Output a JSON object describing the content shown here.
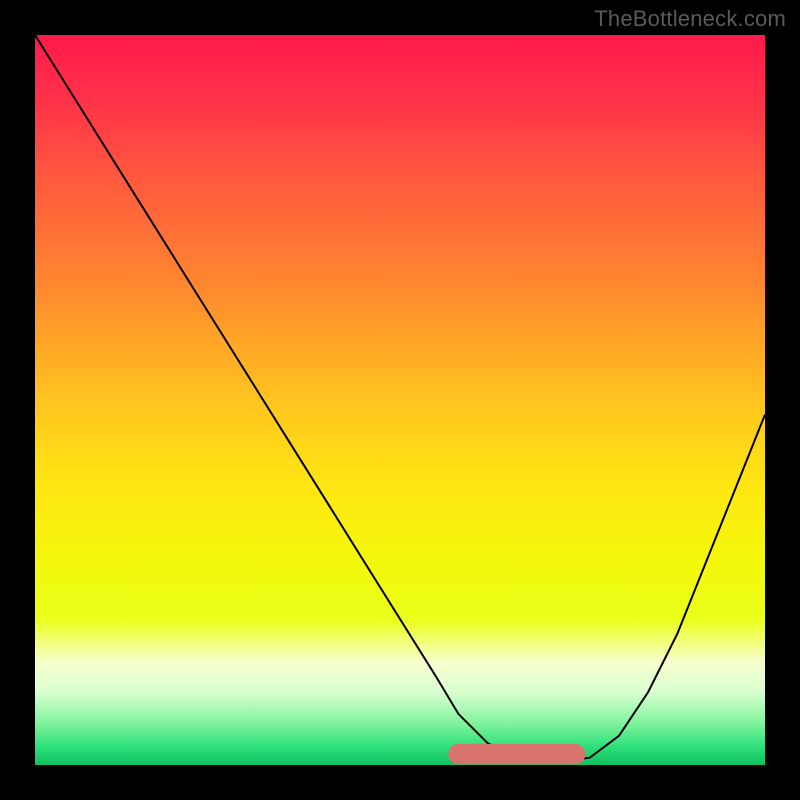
{
  "watermark": "TheBottleneck.com",
  "chart_data": {
    "type": "line",
    "title": "",
    "xlabel": "",
    "ylabel": "",
    "xlim": [
      0,
      100
    ],
    "ylim": [
      0,
      100
    ],
    "background_gradient": {
      "stops": [
        {
          "offset": 0.0,
          "color": "#ff1a4a"
        },
        {
          "offset": 0.08,
          "color": "#ff2f4a"
        },
        {
          "offset": 0.2,
          "color": "#ff5a3e"
        },
        {
          "offset": 0.35,
          "color": "#ff8a2e"
        },
        {
          "offset": 0.5,
          "color": "#ffc41f"
        },
        {
          "offset": 0.62,
          "color": "#ffe712"
        },
        {
          "offset": 0.72,
          "color": "#f4f80a"
        },
        {
          "offset": 0.8,
          "color": "#e9ff1a"
        },
        {
          "offset": 0.86,
          "color": "#f8ffd0"
        },
        {
          "offset": 0.9,
          "color": "#d9ffd0"
        },
        {
          "offset": 0.94,
          "color": "#86f5a0"
        },
        {
          "offset": 0.975,
          "color": "#2ee07a"
        },
        {
          "offset": 1.0,
          "color": "#10c060"
        }
      ]
    },
    "series": [
      {
        "name": "bottleneck-curve",
        "stroke": "#000000",
        "stroke_width": 2,
        "x": [
          0,
          5,
          10,
          15,
          20,
          25,
          30,
          35,
          40,
          45,
          50,
          55,
          58,
          62,
          66,
          70,
          72,
          76,
          80,
          84,
          88,
          92,
          96,
          100
        ],
        "y": [
          100,
          92,
          84,
          76,
          68,
          60,
          52,
          44,
          36,
          28,
          20,
          12,
          7,
          3,
          1,
          0.5,
          0.5,
          1,
          4,
          10,
          18,
          28,
          38,
          48
        ]
      }
    ],
    "highlight_band": {
      "name": "optimal-range",
      "color": "#d9736e",
      "x_start": 58,
      "x_end": 74,
      "y": 1.5,
      "thickness": 2.8
    }
  }
}
